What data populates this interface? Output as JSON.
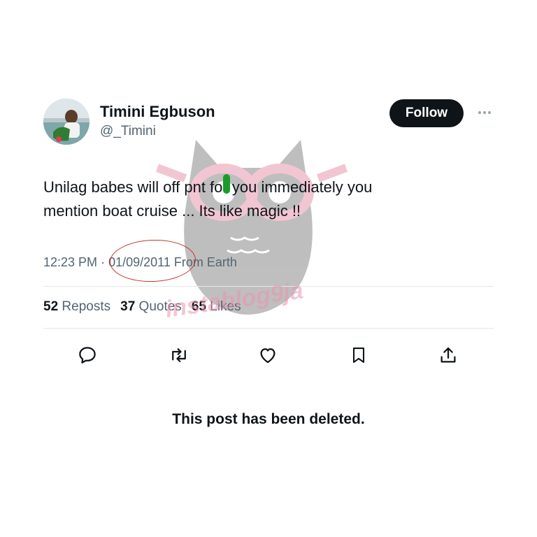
{
  "tweet": {
    "author_name": "Timini Egbuson",
    "author_handle": "@_Timini",
    "follow_label": "Follow",
    "text_line1": "Unilag babes will off p​nt for you immediately you",
    "text_line2": "mention boat cruise ... Its like magic !!",
    "time": "12:23 PM",
    "separator": "·",
    "date": "01/09/2011",
    "source": "From Earth",
    "reposts_count": "52",
    "reposts_label": "Reposts",
    "quotes_count": "37",
    "quotes_label": "Quotes",
    "likes_count": "65",
    "likes_label": "Likes"
  },
  "actions": [
    "reply-icon",
    "repost-icon",
    "like-icon",
    "bookmark-icon",
    "share-icon"
  ],
  "watermark": {
    "text": "instablog9ja"
  },
  "deleted_notice": "This post has been deleted.",
  "colors": {
    "text": "#0f1419",
    "muted": "#536471",
    "follow_bg": "#0f1419",
    "annotation_circle": "#c0392b",
    "watermark_pink": "#e996af"
  }
}
